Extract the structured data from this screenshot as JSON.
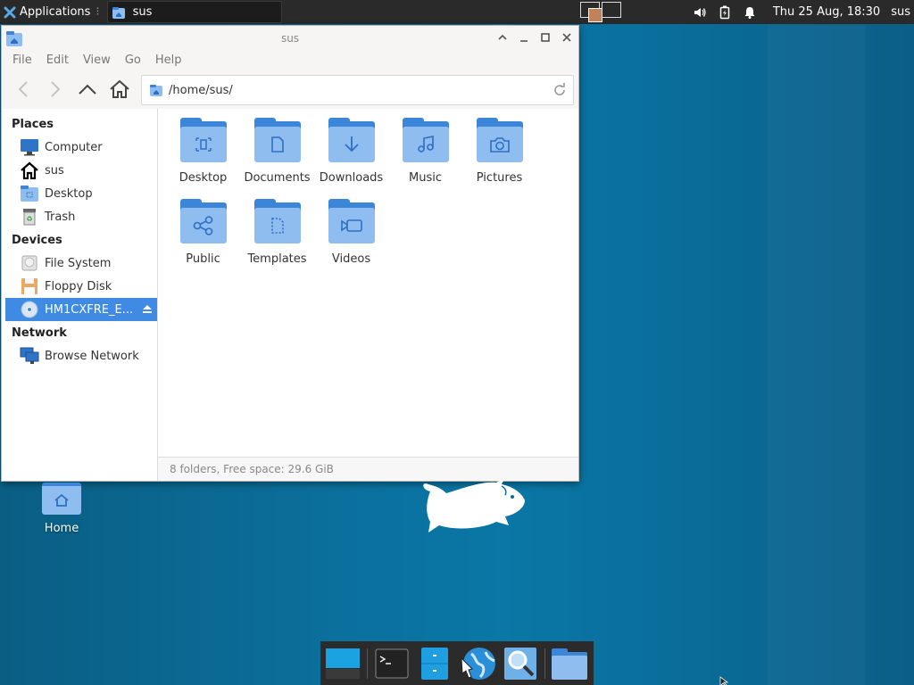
{
  "top_panel": {
    "applications_label": "Applications",
    "task_label": "sus",
    "clock": "Thu 25 Aug, 18:30",
    "user": "sus"
  },
  "window": {
    "title": "sus",
    "menu": [
      "File",
      "Edit",
      "View",
      "Go",
      "Help"
    ],
    "path": "/home/sus/",
    "sidebar": {
      "places_header": "Places",
      "places": [
        "Computer",
        "sus",
        "Desktop",
        "Trash"
      ],
      "devices_header": "Devices",
      "devices": [
        "File System",
        "Floppy Disk",
        "HM1CXFRE_E..."
      ],
      "network_header": "Network",
      "network": [
        "Browse Network"
      ]
    },
    "folders": [
      "Desktop",
      "Documents",
      "Downloads",
      "Music",
      "Pictures",
      "Public",
      "Templates",
      "Videos"
    ],
    "status": "8 folders, Free space: 29.6 GiB"
  },
  "desktop": {
    "home_label": "Home"
  },
  "colors": {
    "accent": "#3f8ae2",
    "folder_dark": "#3c86d9",
    "folder_light": "#8fbdf0",
    "panel": "#2a2a2a"
  }
}
